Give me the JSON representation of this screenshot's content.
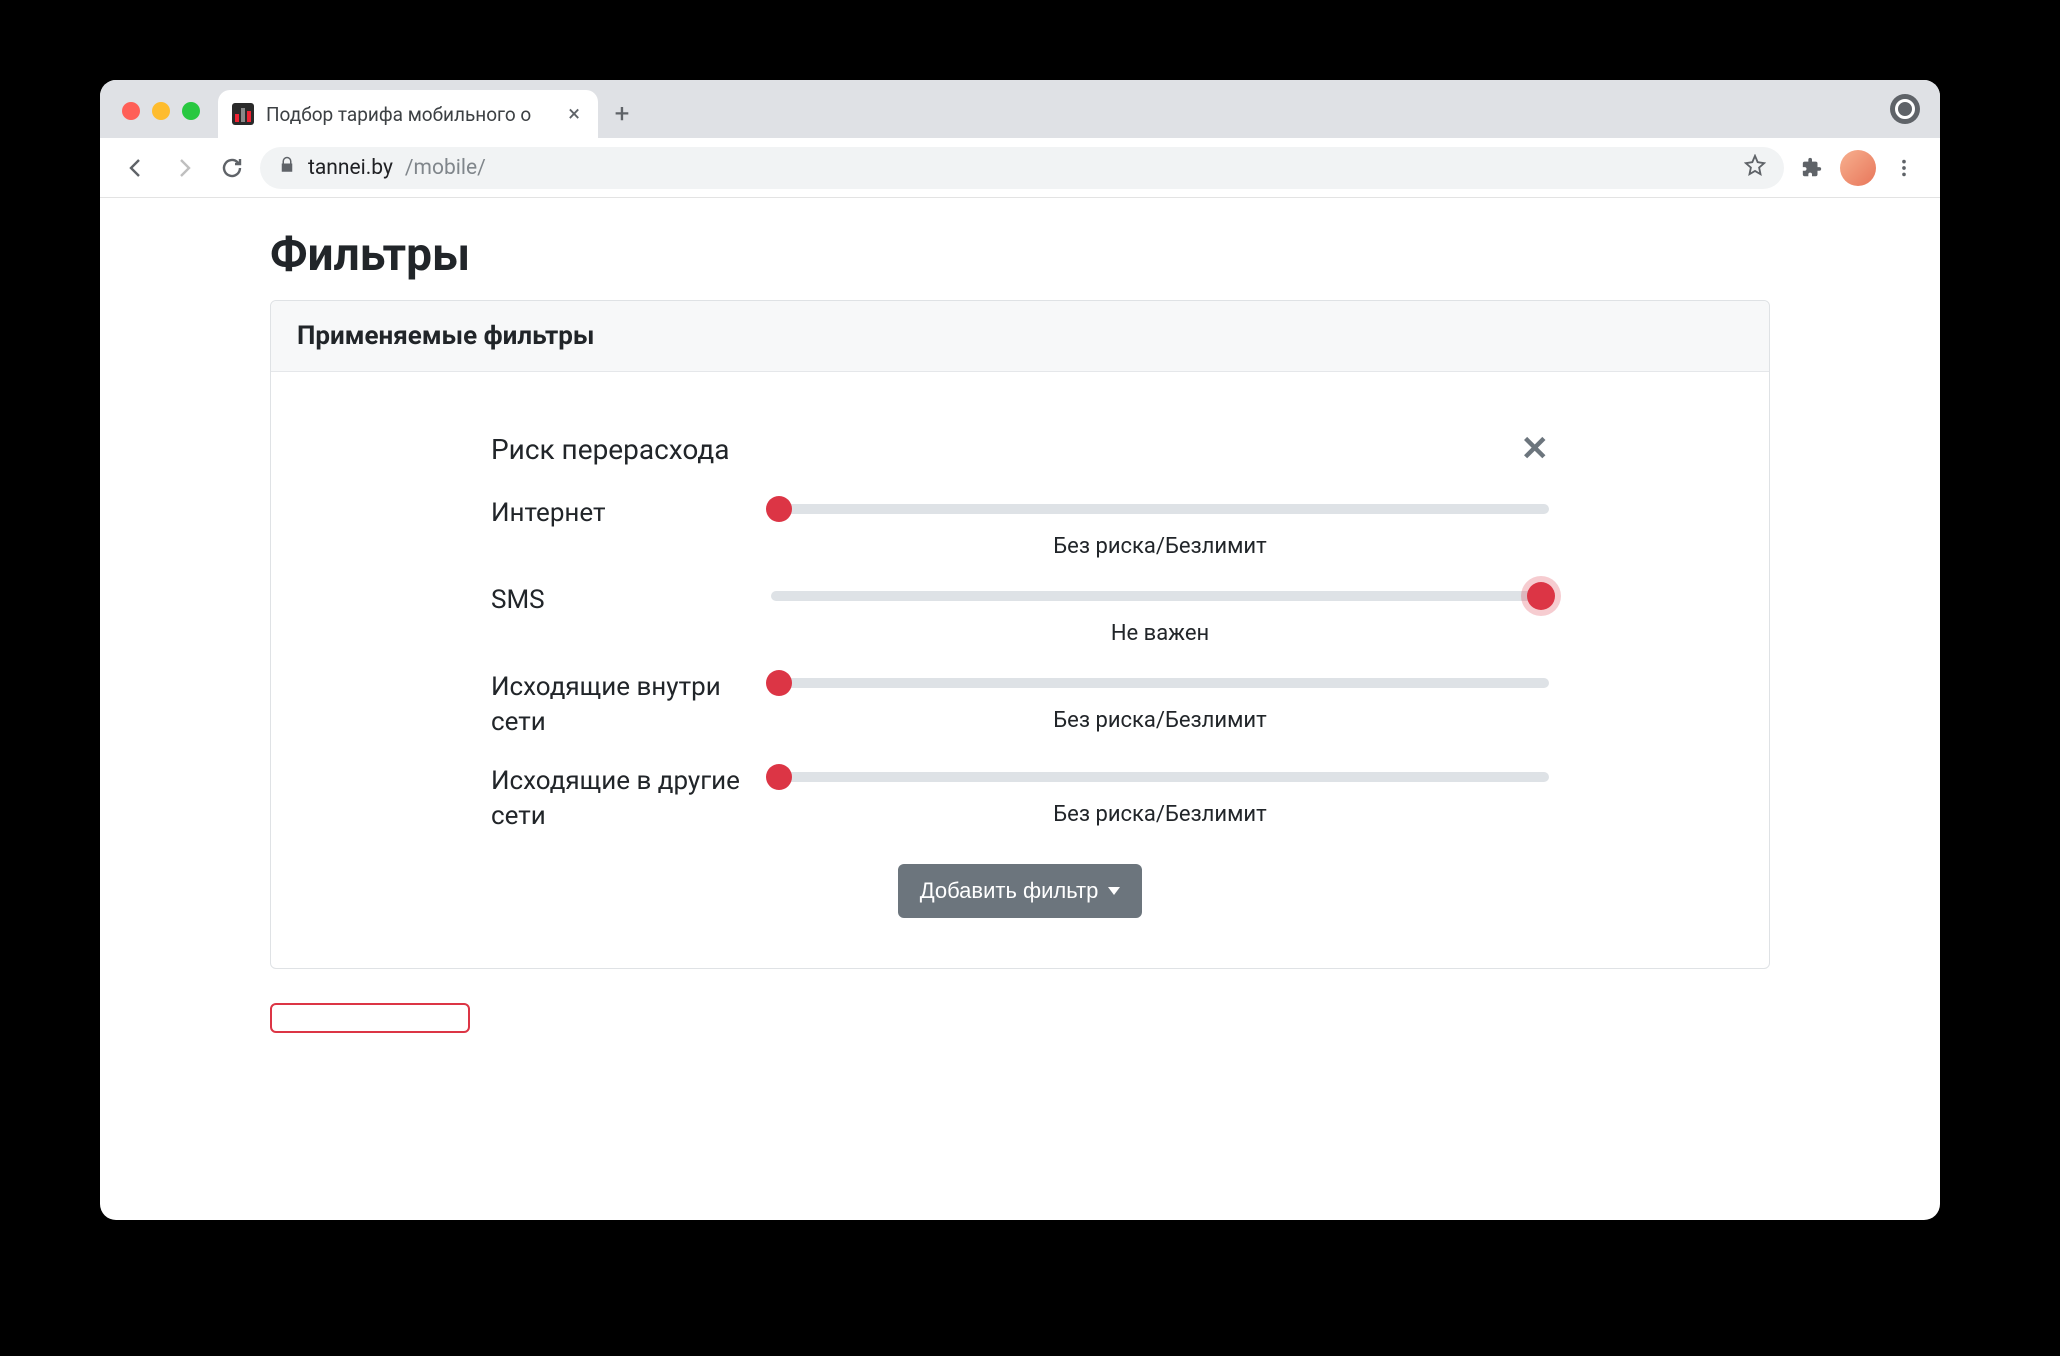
{
  "browser": {
    "tab_title": "Подбор тарифа мобильного о",
    "url_host": "tannei.by",
    "url_path": "/mobile/"
  },
  "page": {
    "title": "Фильтры",
    "card_title": "Применяемые фильтры",
    "filter_group": {
      "title": "Риск перерасхода",
      "rows": [
        {
          "label": "Интернет",
          "caption": "Без риска/Безлимит",
          "pos": 0,
          "focus": false
        },
        {
          "label": "SMS",
          "caption": "Не важен",
          "pos": 100,
          "focus": true
        },
        {
          "label": "Исходящие внутри сети",
          "caption": "Без риска/Безлимит",
          "pos": 0,
          "focus": false
        },
        {
          "label": "Исходящие в другие сети",
          "caption": "Без риска/Безлимит",
          "pos": 0,
          "focus": false
        }
      ]
    },
    "add_filter_label": "Добавить фильтр"
  }
}
